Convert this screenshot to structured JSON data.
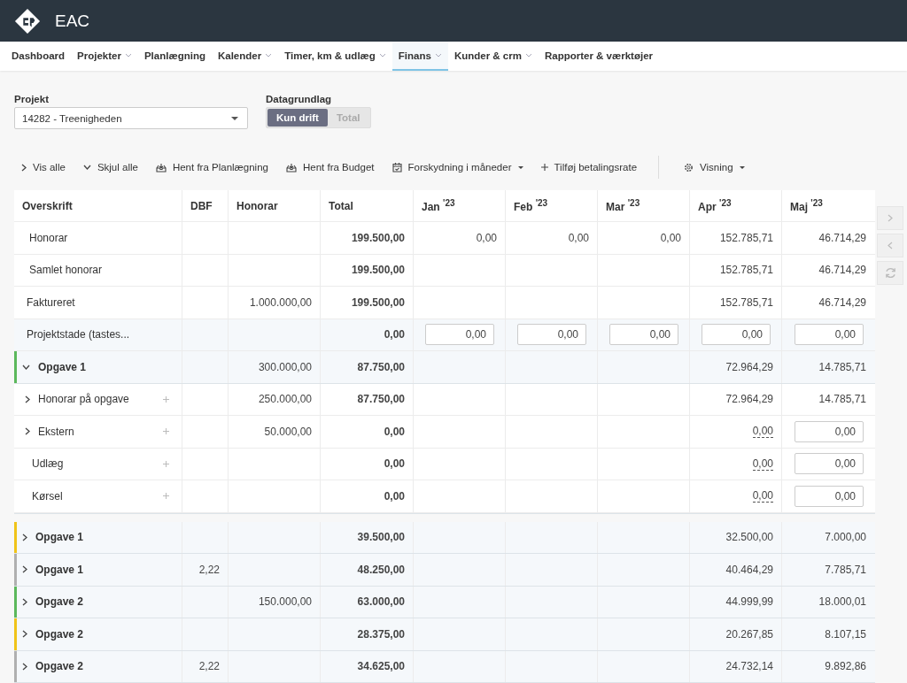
{
  "app": {
    "title": "EAC"
  },
  "nav": [
    {
      "label": "Dashboard",
      "menu": false,
      "selected": false
    },
    {
      "label": "Projekter",
      "menu": true,
      "selected": false
    },
    {
      "label": "Planlægning",
      "menu": false,
      "selected": false
    },
    {
      "label": "Kalender",
      "menu": true,
      "selected": false
    },
    {
      "label": "Timer, km & udlæg",
      "menu": true,
      "selected": false
    },
    {
      "label": "Finans",
      "menu": true,
      "selected": true
    },
    {
      "label": "Kunder & crm",
      "menu": true,
      "selected": false
    },
    {
      "label": "Rapporter & værktøjer",
      "menu": false,
      "selected": false
    }
  ],
  "project": {
    "label": "Projekt",
    "value": "14282 - Treenigheden"
  },
  "data_basis": {
    "label": "Datagrundlag",
    "options": [
      {
        "label": "Kun drift",
        "selected": true
      },
      {
        "label": "Total",
        "selected": false
      }
    ]
  },
  "toolbar": [
    {
      "label": "Vis alle",
      "kind": "expand",
      "menu": false
    },
    {
      "label": "Skjul alle",
      "kind": "collapse",
      "menu": false
    },
    {
      "label": "Hent fra Planlægning",
      "kind": "import",
      "menu": false
    },
    {
      "label": "Hent fra Budget",
      "kind": "import",
      "menu": false
    },
    {
      "label": "Forskydning i måneder",
      "kind": "shift",
      "menu": true
    },
    {
      "label": "Tilføj betalingsrate",
      "kind": "add",
      "menu": false
    },
    {
      "label": "Visning",
      "kind": "view",
      "menu": true
    }
  ],
  "columns": [
    "Overskrift",
    "DBF",
    "Honorar",
    "Total",
    "Jan $^{'23}$",
    "Feb $^{'23}$",
    "Mar $^{'23}$",
    "Apr $^{'23}$",
    "Maj $^{'23}$"
  ],
  "rows": [
    {
      "kind": "sum",
      "label": "Honorar",
      "cells": [
        null,
        null,
        "199.500,00",
        "0,00",
        "0,00",
        "0,00",
        "152.785,71",
        "46.714,29"
      ]
    },
    {
      "kind": "sum",
      "label": "Samlet honorar",
      "cells": [
        null,
        null,
        "199.500,00",
        null,
        null,
        null,
        "152.785,71",
        "46.714,29"
      ]
    },
    {
      "kind": "plain",
      "label": "Faktureret",
      "cells": [
        null,
        "1.000.000,00",
        "199.500,00",
        null,
        null,
        null,
        "152.785,71",
        "46.714,29"
      ]
    },
    {
      "kind": "stade",
      "label": "Projektstade (tastes...",
      "cells": [
        null,
        null,
        "0,00",
        {
          "kind": "input",
          "value": "0,00"
        },
        {
          "kind": "input",
          "value": "0,00"
        },
        {
          "kind": "input",
          "value": "0,00"
        },
        {
          "kind": "input",
          "value": "0,00"
        },
        {
          "kind": "input",
          "value": "0,00"
        }
      ]
    },
    {
      "kind": "group",
      "label": "Opgave 1",
      "color": "#5cb85c",
      "expanded": true,
      "cells": [
        null,
        "300.000,00",
        "87.750,00",
        null,
        null,
        null,
        "72.964,29",
        "14.785,71"
      ],
      "children": [
        {
          "kind": "sub",
          "label": "Honorar på opgave",
          "expanded": false,
          "addable": true,
          "cells": [
            null,
            "250.000,00",
            "87.750,00",
            null,
            null,
            null,
            "72.964,29",
            "14.785,71"
          ]
        },
        {
          "kind": "sub",
          "label": "Ekstern",
          "expanded": false,
          "addable": true,
          "cells": [
            null,
            "50.000,00",
            "0,00",
            null,
            null,
            null,
            {
              "kind": "link",
              "value": "0,00"
            },
            {
              "kind": "input",
              "value": "0,00"
            }
          ]
        },
        {
          "kind": "sub",
          "label": "Udlæg",
          "addable": true,
          "cells": [
            null,
            null,
            "0,00",
            null,
            null,
            null,
            {
              "kind": "link",
              "value": "0,00"
            },
            {
              "kind": "input",
              "value": "0,00"
            }
          ]
        },
        {
          "kind": "sub",
          "label": "Kørsel",
          "addable": true,
          "cells": [
            null,
            null,
            "0,00",
            null,
            null,
            null,
            {
              "kind": "link",
              "value": "0,00"
            },
            {
              "kind": "input",
              "value": "0,00"
            }
          ]
        }
      ]
    }
  ],
  "tasks": [
    {
      "kind": "group",
      "label": "Opgave 1",
      "color": "#f0c419",
      "expanded": false,
      "cells": [
        null,
        null,
        "39.500,00",
        null,
        null,
        null,
        "32.500,00",
        "7.000,00"
      ]
    },
    {
      "kind": "group",
      "label": "Opgave 1",
      "color": "#b0b0b0",
      "expanded": false,
      "cells": [
        "2,22",
        null,
        "48.250,00",
        null,
        null,
        null,
        "40.464,29",
        "7.785,71"
      ]
    },
    {
      "kind": "group",
      "label": "Opgave 2",
      "color": "#5cb85c",
      "expanded": false,
      "cells": [
        null,
        "150.000,00",
        "63.000,00",
        null,
        null,
        null,
        "44.999,99",
        "18.000,01"
      ]
    },
    {
      "kind": "group",
      "label": "Opgave 2",
      "color": "#f0c419",
      "expanded": false,
      "cells": [
        null,
        null,
        "28.375,00",
        null,
        null,
        null,
        "20.267,85",
        "8.107,15"
      ]
    },
    {
      "kind": "group",
      "label": "Opgave 2",
      "color": "#b0b0b0",
      "expanded": false,
      "cells": [
        "2,22",
        null,
        "34.625,00",
        null,
        null,
        null,
        "24.732,14",
        "9.892,86"
      ]
    }
  ]
}
